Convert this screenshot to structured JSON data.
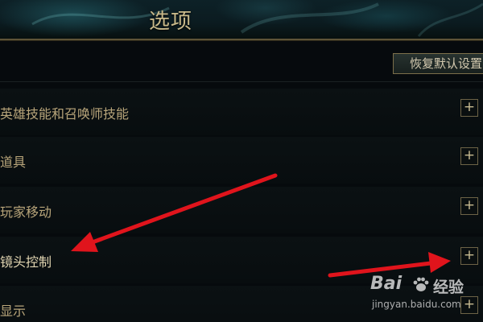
{
  "header": {
    "title": "选项"
  },
  "toolbar": {
    "restore_label": "恢复默认设置"
  },
  "sections": [
    {
      "label": "英雄技能和召唤师技能",
      "expand": "+"
    },
    {
      "label": "道具",
      "expand": "+"
    },
    {
      "label": "玩家移动",
      "expand": "+"
    },
    {
      "label": "镜头控制",
      "expand": "+"
    },
    {
      "label": "显示",
      "expand": "+"
    }
  ],
  "watermark": {
    "brand": "Bai",
    "brand_cn": "经验",
    "url": "jingyan.baidu.com"
  },
  "colors": {
    "gold_text": "#b8a57a",
    "highlight_text": "#e2d6b2",
    "arrow_red": "#e0141c",
    "background": "#060a0d"
  }
}
